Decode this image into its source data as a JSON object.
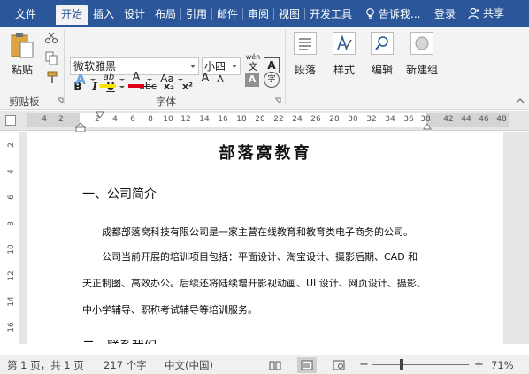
{
  "tabs": [
    {
      "label": "文件",
      "active": false
    },
    {
      "label": "开始",
      "active": true
    },
    {
      "label": "插入",
      "active": false
    },
    {
      "label": "设计",
      "active": false
    },
    {
      "label": "布局",
      "active": false
    },
    {
      "label": "引用",
      "active": false
    },
    {
      "label": "邮件",
      "active": false
    },
    {
      "label": "审阅",
      "active": false
    },
    {
      "label": "视图",
      "active": false
    },
    {
      "label": "开发工具",
      "active": false
    }
  ],
  "tellme": "告诉我...",
  "signin": "登录",
  "share": "共享",
  "ribbon": {
    "paste": "粘贴",
    "clipboard_label": "剪贴板",
    "font_label": "字体",
    "font_name": "微软雅黑",
    "font_size": "小四",
    "phonetic_top": "wén",
    "phonetic_bottom": "文",
    "border_char": "A",
    "bold": "B",
    "italic": "I",
    "underline": "U",
    "strike": "abc",
    "subscript": "x₂",
    "superscript": "x²",
    "text_effect": "A",
    "highlight": "ab",
    "font_color": "A",
    "change_case": "Aa",
    "grow_font": "A",
    "shrink_font": "A",
    "char_shading": "A",
    "enclose": "字",
    "paragraph": "段落",
    "styles": "样式",
    "editing": "编辑",
    "new_group": "新建组",
    "highlight_color": "#f5e400",
    "font_color_value": "#e0001b",
    "accent": "#2b579a"
  },
  "ruler": {
    "h_left": [
      "4",
      "2"
    ],
    "h_main": [
      "2",
      "4",
      "6",
      "8",
      "10",
      "12",
      "14",
      "16",
      "18",
      "20",
      "22",
      "24",
      "26",
      "28",
      "30",
      "32",
      "34",
      "36",
      "38"
    ],
    "h_right": [
      "42",
      "44",
      "46",
      "48"
    ],
    "v_nums": [
      "2",
      "4",
      "6",
      "8",
      "10",
      "12",
      "14",
      "16"
    ]
  },
  "doc": {
    "title": "部落窝教育",
    "h1": "一、公司简介",
    "p1": "成都部落窝科技有限公司是一家主营在线教育和教育类电子商务的公司。",
    "p2_line1": "公司当前开展的培训项目包括：平面设计、淘宝设计、摄影后期、CAD 和",
    "p2_line2": "天正制图、高效办公。后续还将陆续增开影视动画、UI 设计、网页设计、摄影、",
    "p2_line3": "中小学辅导、职称考试辅导等培训服务。",
    "h2": "二、联系我们"
  },
  "status": {
    "page": "第 1 页，共 1 页",
    "words": "217 个字",
    "language": "中文(中国)",
    "zoom": "71%",
    "minus": "−",
    "plus": "+"
  }
}
